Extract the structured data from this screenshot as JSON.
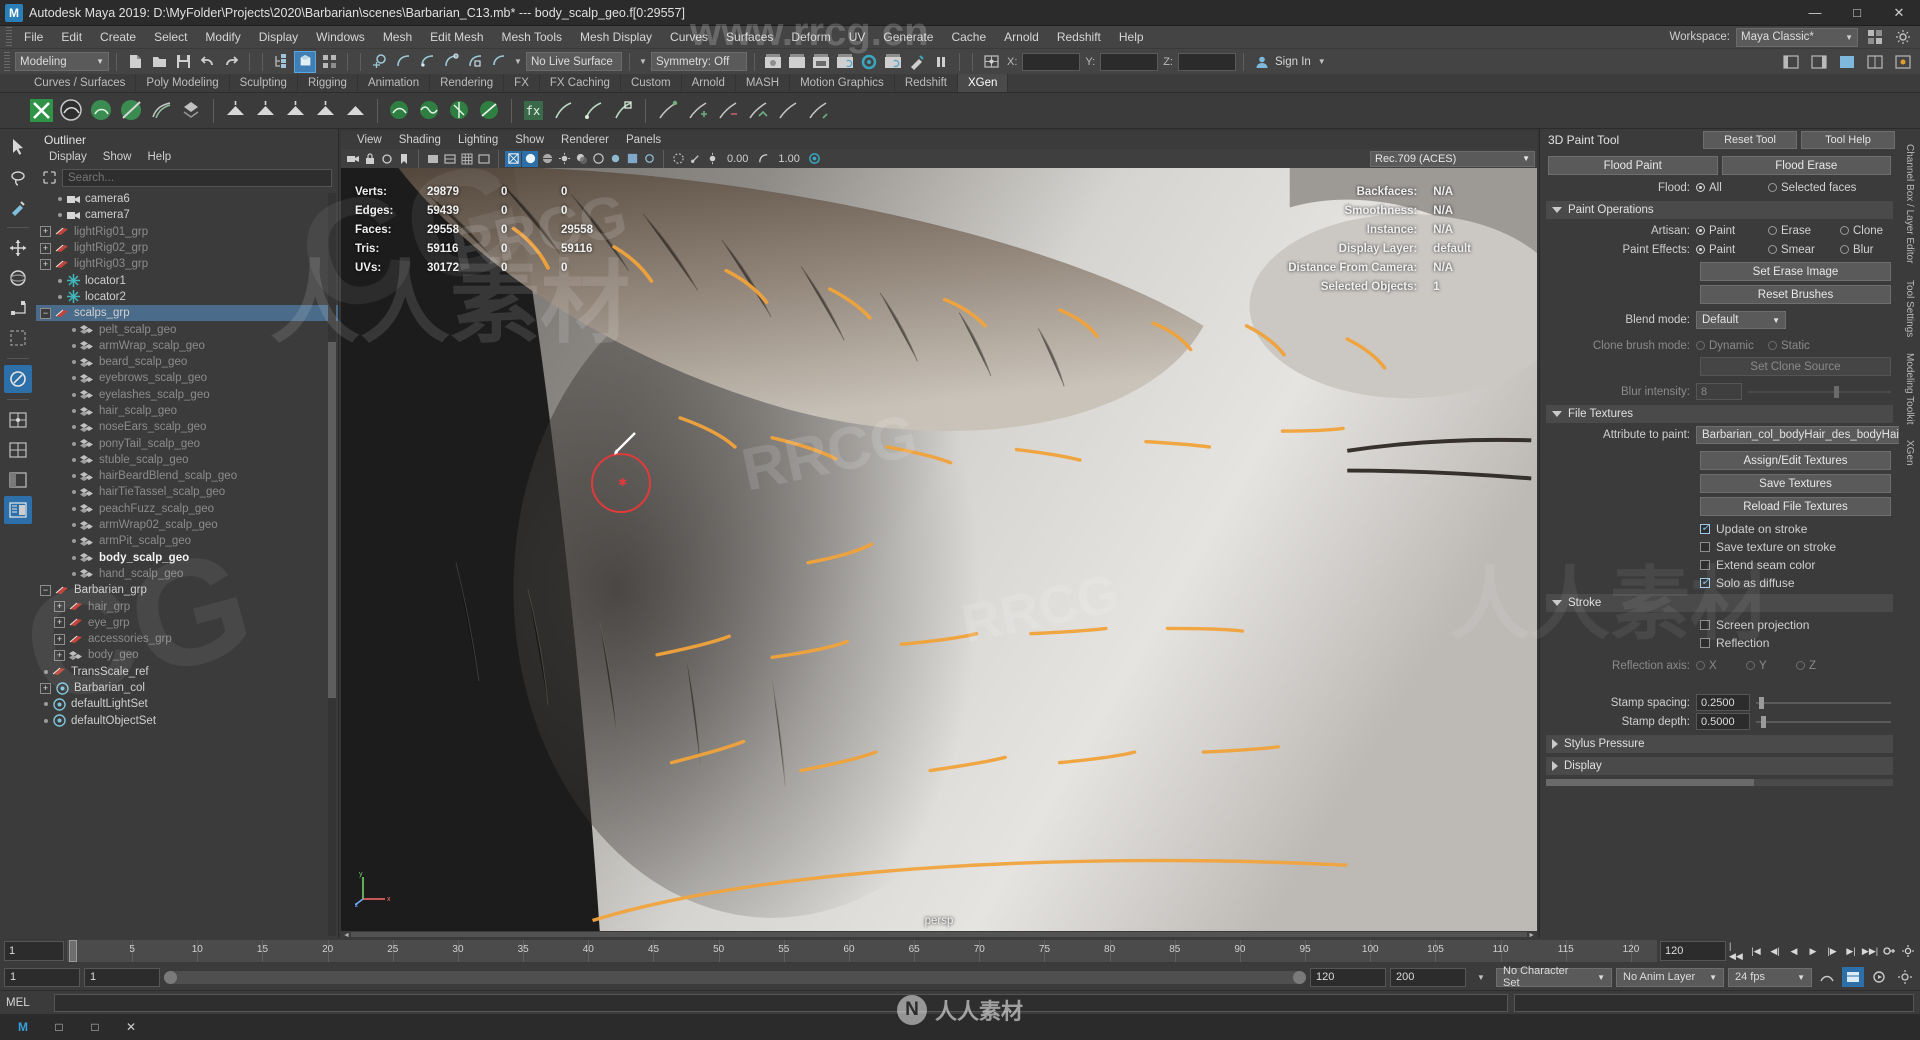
{
  "window": {
    "title": "Autodesk Maya 2019: D:\\MyFolder\\Projects\\2020\\Barbarian\\scenes\\Barbarian_C13.mb*  ---  body_scalp_geo.f[0:29557]",
    "logo": "M",
    "minimize": "—",
    "maximize": "□",
    "close": "✕"
  },
  "menubar": {
    "items": [
      "File",
      "Edit",
      "Create",
      "Select",
      "Modify",
      "Display",
      "Windows",
      "Mesh",
      "Edit Mesh",
      "Mesh Tools",
      "Mesh Display",
      "Curves",
      "Surfaces",
      "Deform",
      "UV",
      "Generate",
      "Cache",
      "Arnold",
      "Redshift",
      "Help"
    ],
    "workspace_label": "Workspace:",
    "workspace_value": "Maya Classic*"
  },
  "statusbar": {
    "menuset": "Modeling",
    "live_surface": "No Live Surface",
    "symmetry": "Symmetry: Off",
    "signin": "Sign In",
    "x_label": "X:",
    "y_label": "Y:",
    "z_label": "Z:",
    "x_value": "",
    "y_value": "",
    "z_value": ""
  },
  "shelf": {
    "tabs": [
      "Curves / Surfaces",
      "Poly Modeling",
      "Sculpting",
      "Rigging",
      "Animation",
      "Rendering",
      "FX",
      "FX Caching",
      "Custom",
      "Arnold",
      "MASH",
      "Motion Graphics",
      "Redshift",
      "XGen"
    ],
    "active_tab": "XGen"
  },
  "outliner": {
    "title": "Outliner",
    "menu": [
      "Display",
      "Show",
      "Help"
    ],
    "search_placeholder": "Search...",
    "items": [
      {
        "label": "camera6",
        "depth": 1,
        "icon": "camera-icon",
        "expand": "none",
        "style": "normal"
      },
      {
        "label": "camera7",
        "depth": 1,
        "icon": "camera-icon",
        "expand": "none",
        "style": "normal"
      },
      {
        "label": "lightRig01_grp",
        "depth": 0,
        "icon": "group-icon",
        "expand": "plus",
        "style": "dim"
      },
      {
        "label": "lightRig02_grp",
        "depth": 0,
        "icon": "group-icon",
        "expand": "plus",
        "style": "dim"
      },
      {
        "label": "lightRig03_grp",
        "depth": 0,
        "icon": "group-icon",
        "expand": "plus",
        "style": "dim"
      },
      {
        "label": "locator1",
        "depth": 1,
        "icon": "locator-icon",
        "expand": "none",
        "style": "normal"
      },
      {
        "label": "locator2",
        "depth": 1,
        "icon": "locator-icon",
        "expand": "none",
        "style": "normal"
      },
      {
        "label": "scalps_grp",
        "depth": 0,
        "icon": "group-icon",
        "expand": "minus",
        "style": "selected"
      },
      {
        "label": "pelt_scalp_geo",
        "depth": 2,
        "icon": "mesh-icon",
        "expand": "none",
        "style": "dim"
      },
      {
        "label": "armWrap_scalp_geo",
        "depth": 2,
        "icon": "mesh-icon",
        "expand": "none",
        "style": "dim"
      },
      {
        "label": "beard_scalp_geo",
        "depth": 2,
        "icon": "mesh-icon",
        "expand": "none",
        "style": "dim"
      },
      {
        "label": "eyebrows_scalp_geo",
        "depth": 2,
        "icon": "mesh-icon",
        "expand": "none",
        "style": "dim"
      },
      {
        "label": "eyelashes_scalp_geo",
        "depth": 2,
        "icon": "mesh-icon",
        "expand": "none",
        "style": "dim"
      },
      {
        "label": "hair_scalp_geo",
        "depth": 2,
        "icon": "mesh-icon",
        "expand": "none",
        "style": "dim"
      },
      {
        "label": "noseEars_scalp_geo",
        "depth": 2,
        "icon": "mesh-icon",
        "expand": "none",
        "style": "dim"
      },
      {
        "label": "ponyTail_scalp_geo",
        "depth": 2,
        "icon": "mesh-icon",
        "expand": "none",
        "style": "dim"
      },
      {
        "label": "stuble_scalp_geo",
        "depth": 2,
        "icon": "mesh-icon",
        "expand": "none",
        "style": "dim"
      },
      {
        "label": "hairBeardBlend_scalp_geo",
        "depth": 2,
        "icon": "mesh-icon",
        "expand": "none",
        "style": "dim"
      },
      {
        "label": "hairTieTassel_scalp_geo",
        "depth": 2,
        "icon": "mesh-icon",
        "expand": "none",
        "style": "dim"
      },
      {
        "label": "peachFuzz_scalp_geo",
        "depth": 2,
        "icon": "mesh-icon",
        "expand": "none",
        "style": "dim"
      },
      {
        "label": "armWrap02_scalp_geo",
        "depth": 2,
        "icon": "mesh-icon",
        "expand": "none",
        "style": "dim"
      },
      {
        "label": "armPit_scalp_geo",
        "depth": 2,
        "icon": "mesh-icon",
        "expand": "none",
        "style": "dim"
      },
      {
        "label": "body_scalp_geo",
        "depth": 2,
        "icon": "mesh-icon",
        "expand": "none",
        "style": "bold"
      },
      {
        "label": "hand_scalp_geo",
        "depth": 2,
        "icon": "mesh-icon",
        "expand": "none",
        "style": "dim"
      },
      {
        "label": "Barbarian_grp",
        "depth": 0,
        "icon": "group-icon",
        "expand": "minus",
        "style": "normal"
      },
      {
        "label": "hair_grp",
        "depth": 1,
        "icon": "group-icon",
        "expand": "plus",
        "style": "dim"
      },
      {
        "label": "eye_grp",
        "depth": 1,
        "icon": "group-icon",
        "expand": "plus",
        "style": "dim"
      },
      {
        "label": "accessories_grp",
        "depth": 1,
        "icon": "group-icon",
        "expand": "plus",
        "style": "dim"
      },
      {
        "label": "body_geo",
        "depth": 1,
        "icon": "mesh-icon",
        "expand": "plus",
        "style": "dim"
      },
      {
        "label": "TransScale_ref",
        "depth": 0,
        "icon": "group-icon",
        "expand": "none",
        "style": "normal"
      },
      {
        "label": "Barbarian_col",
        "depth": 0,
        "icon": "set-icon",
        "expand": "plus",
        "style": "normal"
      },
      {
        "label": "defaultLightSet",
        "depth": 0,
        "icon": "set-icon",
        "expand": "none",
        "style": "normal"
      },
      {
        "label": "defaultObjectSet",
        "depth": 0,
        "icon": "set-icon",
        "expand": "none",
        "style": "normal"
      }
    ]
  },
  "viewport": {
    "menu": [
      "View",
      "Shading",
      "Lighting",
      "Show",
      "Renderer",
      "Panels"
    ],
    "exposure": "0.00",
    "gamma": "1.00",
    "colorspace": "Rec.709 (ACES)",
    "camera_label": "persp",
    "hud_left": [
      {
        "key": "Verts:",
        "v1": "29879",
        "v2": "0",
        "v3": "0"
      },
      {
        "key": "Edges:",
        "v1": "59439",
        "v2": "0",
        "v3": "0"
      },
      {
        "key": "Faces:",
        "v1": "29558",
        "v2": "0",
        "v3": "29558"
      },
      {
        "key": "Tris:",
        "v1": "59116",
        "v2": "0",
        "v3": "59116"
      },
      {
        "key": "UVs:",
        "v1": "30172",
        "v2": "0",
        "v3": "0"
      }
    ],
    "hud_right": [
      {
        "key": "Backfaces:",
        "value": "N/A"
      },
      {
        "key": "Smoothness:",
        "value": "N/A"
      },
      {
        "key": "Instance:",
        "value": "N/A"
      },
      {
        "key": "Display Layer:",
        "value": "default"
      },
      {
        "key": "Distance From Camera:",
        "value": "N/A"
      },
      {
        "key": "Selected Objects:",
        "value": "1"
      }
    ]
  },
  "toolpanel": {
    "title": "3D Paint Tool",
    "reset_tool": "Reset Tool",
    "tool_help": "Tool Help",
    "flood_paint": "Flood Paint",
    "flood_erase": "Flood Erase",
    "paint_operations": {
      "section": "Paint Operations",
      "artisan_label": "Artisan:",
      "artisan_options": [
        "Paint",
        "Erase",
        "Clone"
      ],
      "artisan_value": "Paint",
      "paint_effects_label": "Paint Effects:",
      "paint_effects_options": [
        "Paint",
        "Smear",
        "Blur"
      ],
      "paint_effects_value": "Paint",
      "set_erase_image": "Set Erase Image",
      "reset_brushes": "Reset Brushes",
      "blend_mode_label": "Blend mode:",
      "blend_mode_value": "Default",
      "clone_brush_label": "Clone brush mode:",
      "clone_brush_options": [
        "Dynamic",
        "Static"
      ],
      "clone_brush_value": "Dynamic",
      "set_clone_source": "Set Clone Source",
      "blur_intensity_label": "Blur intensity:",
      "blur_intensity_value": "8"
    },
    "flood_row": {
      "label": "Flood:",
      "options": [
        "All",
        "Selected faces"
      ],
      "value": "All"
    },
    "file_textures": {
      "section": "File Textures",
      "attribute_label": "Attribute to paint:",
      "attribute_value": "Barbarian_col_bodyHair_des_bodyHair_lengthMsk",
      "assign_edit": "Assign/Edit Textures",
      "save_textures": "Save Textures",
      "reload_textures": "Reload File Textures",
      "checkboxes": [
        {
          "label": "Update on stroke",
          "checked": true
        },
        {
          "label": "Save texture on stroke",
          "checked": false
        },
        {
          "label": "Extend seam color",
          "checked": false
        },
        {
          "label": "Solo as diffuse",
          "checked": true
        }
      ]
    },
    "stroke": {
      "section": "Stroke",
      "checkboxes": [
        {
          "label": "Screen projection",
          "checked": false
        },
        {
          "label": "Reflection",
          "checked": false
        }
      ],
      "reflection_axis_label": "Reflection axis:",
      "reflection_axis_options": [
        "X",
        "Y",
        "Z"
      ],
      "reflection_axis_value": "X",
      "stamp_spacing_label": "Stamp spacing:",
      "stamp_spacing_value": "0.2500",
      "stamp_depth_label": "Stamp depth:",
      "stamp_depth_value": "0.5000"
    },
    "stylus_pressure": "Stylus Pressure",
    "display": "Display"
  },
  "rightrail": {
    "tabs": [
      "Channel Box / Layer Editor",
      "Tool Settings",
      "Modeling Toolkit",
      "XGen"
    ]
  },
  "timeline": {
    "current_frame": "1",
    "ticks": [
      5,
      10,
      15,
      20,
      25,
      30,
      35,
      40,
      45,
      50,
      55,
      60,
      65,
      70,
      75,
      80,
      85,
      90,
      95,
      100,
      105,
      110,
      115,
      120
    ],
    "end_display": "120",
    "playback_fields": [
      "1",
      "1",
      "120",
      "120",
      "200"
    ],
    "character_set": "No Character Set",
    "anim_layer": "No Anim Layer",
    "fps": "24 fps",
    "start_anim": "1",
    "start_range": "1",
    "end_range": "120",
    "end_anim": "200"
  },
  "commandline": {
    "mel_label": "MEL"
  },
  "taskbar": {
    "items": [
      "M",
      "□",
      "□",
      "✕"
    ]
  },
  "watermarks": {
    "rrcg": "RRCG",
    "cn": "www.rrcg.cn",
    "cg": "CG",
    "chinese": "人人素材",
    "center_logo": "N"
  },
  "colors": {
    "accent_blue": "#2d6fa8",
    "selection": "#4a6b8a",
    "panel_bg": "#3b3b3b",
    "chrome": "#444444",
    "title_bg": "#2b2b2b",
    "hud_text": "#f0f0f0",
    "brush_red": "#e03a3a",
    "guide_orange": "#f0a33c"
  }
}
